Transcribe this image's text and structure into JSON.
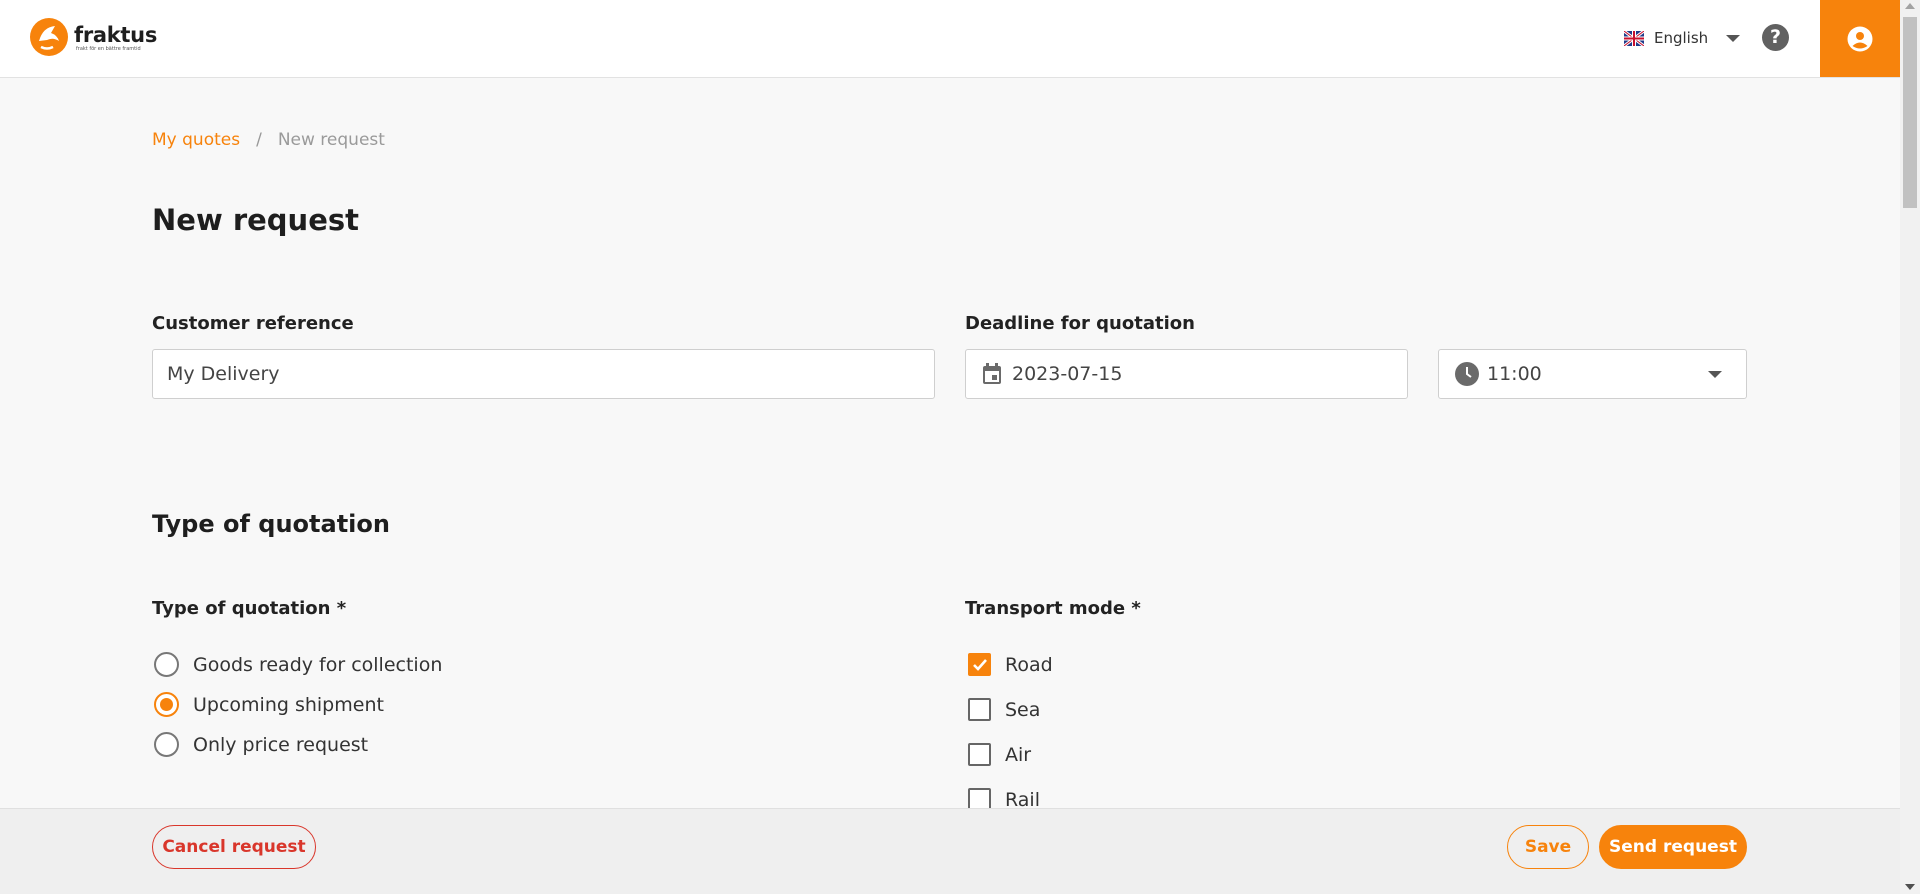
{
  "brand": {
    "name": "fraktus",
    "tagline": "frakt för en bättre framtid"
  },
  "header": {
    "language": "English"
  },
  "breadcrumb": {
    "parent": "My quotes",
    "separator": "/",
    "current": "New request"
  },
  "page": {
    "title": "New request"
  },
  "form": {
    "customer_reference": {
      "label": "Customer reference",
      "value": "My Delivery"
    },
    "deadline": {
      "label": "Deadline for quotation",
      "date": "2023-07-15",
      "time": "11:00"
    }
  },
  "quotation_section": {
    "title": "Type of quotation",
    "type": {
      "label": "Type of quotation *",
      "options": [
        {
          "label": "Goods ready for collection",
          "selected": false
        },
        {
          "label": "Upcoming shipment",
          "selected": true
        },
        {
          "label": "Only price request",
          "selected": false
        }
      ]
    },
    "transport": {
      "label": "Transport mode *",
      "options": [
        {
          "label": "Road",
          "checked": true
        },
        {
          "label": "Sea",
          "checked": false
        },
        {
          "label": "Air",
          "checked": false
        },
        {
          "label": "Rail",
          "checked": false
        }
      ]
    }
  },
  "footer": {
    "cancel": "Cancel request",
    "save": "Save",
    "send": "Send request"
  },
  "colors": {
    "accent": "#f7830c",
    "danger": "#d9362b"
  }
}
